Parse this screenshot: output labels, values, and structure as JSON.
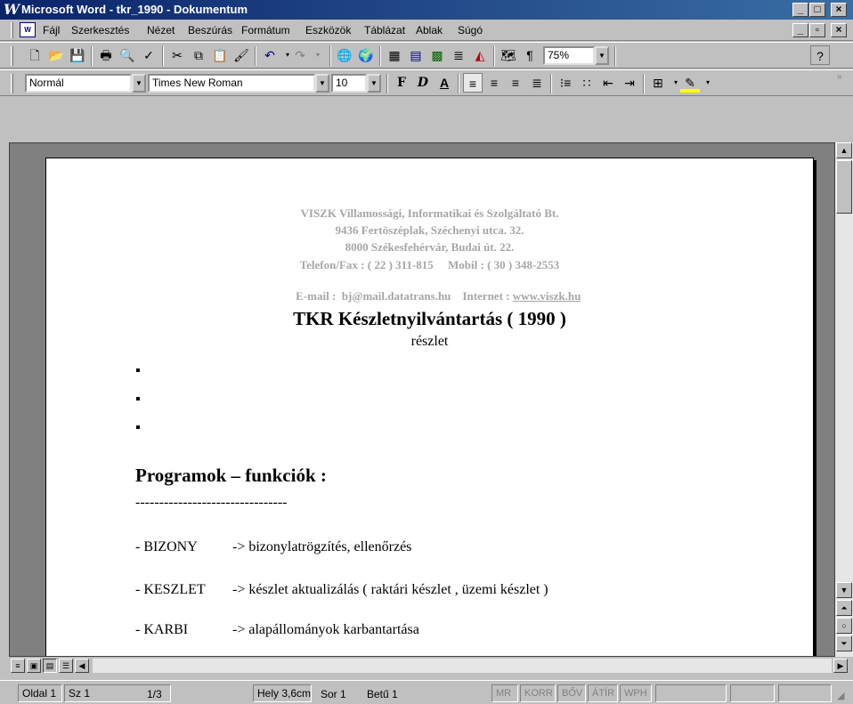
{
  "window": {
    "app_logo": "W",
    "title": "Microsoft Word - tkr_1990 - Dokumentum",
    "controls": {
      "minimize": "_",
      "maximize": "□",
      "close": "×"
    }
  },
  "menu": {
    "items": [
      {
        "label": "Fájl"
      },
      {
        "label": "Szerkesztés"
      },
      {
        "label": "Nézet"
      },
      {
        "label": "Beszúrás"
      },
      {
        "label": "Formátum"
      },
      {
        "label": "Eszközök"
      },
      {
        "label": "Táblázat"
      },
      {
        "label": "Ablak"
      },
      {
        "label": "Súgó"
      }
    ]
  },
  "standard_toolbar": {
    "zoom": "75%"
  },
  "formatting_toolbar": {
    "style": "Normál",
    "font": "Times New Roman",
    "size": "10",
    "bold_glyph": "F",
    "italic_glyph": "D",
    "underline_glyph": "A"
  },
  "document": {
    "company_header": [
      "VISZK Villamossági, Informatikai és Szolgáltató Bt.",
      "9436 Fertöszéplak, Széchenyi utca. 32.",
      "8000 Székesfehérvár, Budai út. 22.",
      "Telefon/Fax : ( 22 ) 311-815     Mobil : ( 30 ) 348-2553"
    ],
    "email_line": "E-mail :  bj@mail.datatrans.hu    Internet : ",
    "website": "www.viszk.hu",
    "title": "TKR Készletnyilvántartás ( 1990 )",
    "subtitle": "részlet",
    "bullets": [
      "▪",
      "▪",
      "▪"
    ],
    "section_heading": "Programok – funkciók :",
    "dash_line": "--------------------------------",
    "functions": [
      {
        "name": "- BIZONY",
        "desc": "->  bizonylatrögzítés, ellenőrzés"
      },
      {
        "name": "- KESZLET",
        "desc": "-> készlet aktualizálás ( raktári készlet , üzemi készlet )"
      },
      {
        "name": "- KARBI",
        "desc": "-> alapállományok karbantartása"
      }
    ]
  },
  "statusbar": {
    "page": "Oldal 1",
    "section": "Sz 1",
    "pages": "1/3",
    "position": "Hely 3,6cm",
    "line": "Sor 1",
    "column": "Betű 1",
    "modes": [
      "MR",
      "KORR",
      "BŐV",
      "ÁTÍR",
      "WPH"
    ]
  },
  "colors": {
    "titlebar_start": "#0a246a",
    "titlebar_end": "#3a6ea5",
    "header_grey": "#a6a6a6",
    "chrome": "#c0c0c0"
  }
}
